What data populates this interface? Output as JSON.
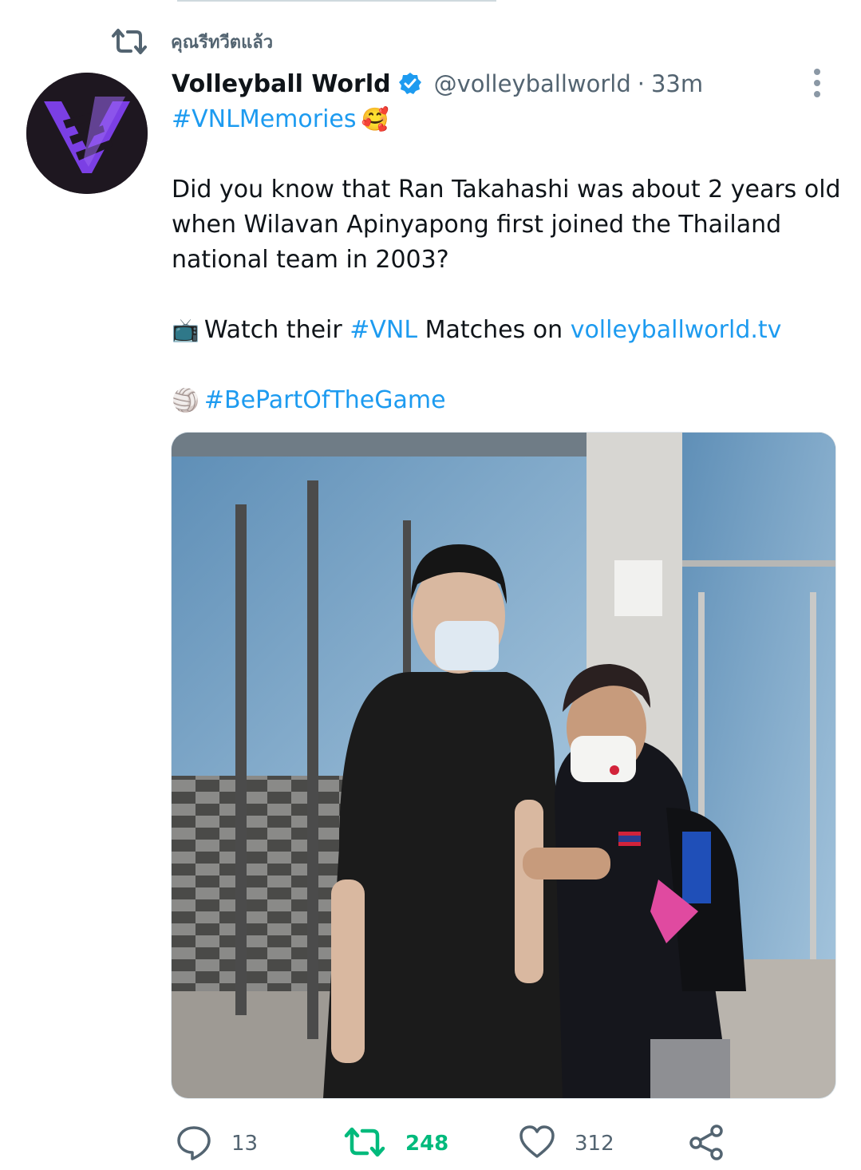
{
  "retweet_context": {
    "label": "คุณรีทวีตแล้ว"
  },
  "tweet": {
    "author_name": "Volleyball World",
    "handle": "@volleyballworld",
    "separator": "·",
    "time": "33m",
    "verified": true,
    "lines": {
      "l1_tag": "#VNLMemories",
      "l1_emoji": "🥰",
      "l2": "Did you know that Ran Takahashi was about 2 years old",
      "l3": "when Wilavan Apinyapong first joined the Thailand",
      "l4": "national team in 2003?",
      "l5_emoji": "📺",
      "l5_pre": "Watch their ",
      "l5_tag": "#VNL",
      "l5_mid": " Matches on ",
      "l5_link": "volleyballworld.tv",
      "l6_emoji": "🏐",
      "l6_tag": "#BePartOfTheGame"
    },
    "media_alt": "Photo of two volleyball players in face masks standing in front of an arena entrance"
  },
  "actions": {
    "reply_count": "13",
    "retweet_count": "248",
    "like_count": "312"
  },
  "colors": {
    "link": "#1d9bf0",
    "muted": "#536471",
    "retweet_active": "#00ba7c",
    "brand_purple": "#7b3fe4"
  },
  "icons": [
    "retweet-icon",
    "verified-badge-icon",
    "more-options-icon",
    "reply-icon",
    "retweet-icon",
    "like-icon",
    "share-icon"
  ]
}
